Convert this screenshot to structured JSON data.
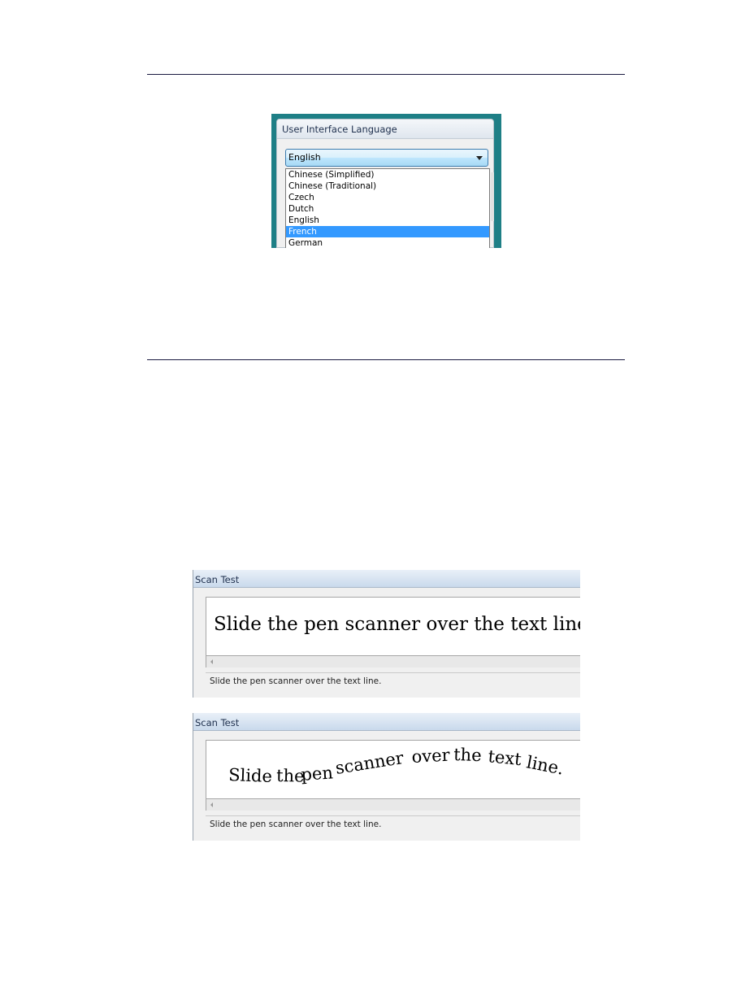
{
  "language_dialog": {
    "title": "User Interface Language",
    "selected_value": "English",
    "dropdown_icon": "chevron-down-icon",
    "options": [
      {
        "label": "Chinese (Simplified)",
        "highlighted": false
      },
      {
        "label": "Chinese (Traditional)",
        "highlighted": false
      },
      {
        "label": "Czech",
        "highlighted": false
      },
      {
        "label": "Dutch",
        "highlighted": false
      },
      {
        "label": "English",
        "highlighted": false
      },
      {
        "label": "French",
        "highlighted": true
      },
      {
        "label": "German",
        "highlighted": false
      }
    ],
    "colors": {
      "highlight": "#3399ff",
      "background": "#1e7f86"
    }
  },
  "scan_test_1": {
    "title": "Scan Test",
    "scanned_text": "Slide the pen scanner over the text line.",
    "status": "Slide the pen scanner over the text line."
  },
  "scan_test_2": {
    "title": "Scan Test",
    "scanned_words": [
      "Slide",
      "the",
      "pen",
      "scanner",
      "over",
      "the",
      "text",
      "line."
    ],
    "status": "Slide the pen scanner over the text line."
  }
}
